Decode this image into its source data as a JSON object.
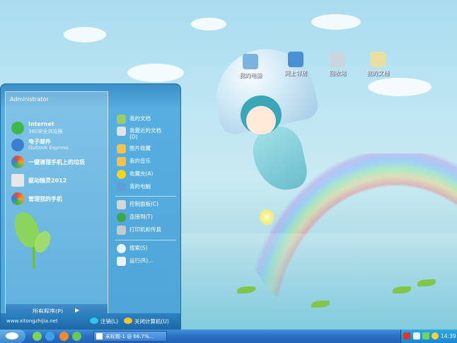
{
  "desktop": {
    "icons": [
      {
        "label": "我的电脑",
        "icon": "my-computer-icon",
        "color": "#7ab3e0"
      },
      {
        "label": "网上邻居",
        "icon": "network-icon",
        "color": "#4a8fd6"
      },
      {
        "label": "回收站",
        "icon": "recycle-bin-icon",
        "color": "#c9d6df"
      },
      {
        "label": "我的文档",
        "icon": "my-documents-icon",
        "color": "#e9e0a0"
      }
    ]
  },
  "start_menu": {
    "user": "Administrator",
    "pinned": [
      {
        "title": "Internet",
        "subtitle": "360安全浏览器",
        "icon": "browser-360-icon",
        "color": "#3fb84a"
      },
      {
        "title": "电子邮件",
        "subtitle": "Outlook Express",
        "icon": "mail-icon",
        "color": "#3c7fd0"
      },
      {
        "title": "一键清理手机上的垃圾",
        "subtitle": "",
        "icon": "phone-clean-icon",
        "color": "#f0a020"
      },
      {
        "title": "驱动精灵2012",
        "subtitle": "",
        "icon": "driver-genius-icon",
        "color": "#e7e7e7"
      },
      {
        "title": "管理我的手机",
        "subtitle": "",
        "icon": "phone-manager-icon",
        "color": "#e94e3c"
      }
    ],
    "all_programs": "所有程序(P)",
    "all_programs_arrow": "▶",
    "right_items": [
      {
        "label": "我的文档",
        "icon": "my-documents-icon",
        "color": "#9acd62"
      },
      {
        "label": "我最近的文档\n(D)",
        "icon": "recent-docs-icon",
        "color": "#e3e3e3"
      },
      {
        "label": "图片收藏",
        "icon": "my-pictures-icon",
        "color": "#f2c24c"
      },
      {
        "label": "我的音乐",
        "icon": "my-music-icon",
        "color": "#f2c24c"
      },
      {
        "label": "收藏夹(A)",
        "icon": "favorites-star-icon",
        "color": "#f7d21e"
      },
      {
        "label": "我的电脑",
        "icon": "my-computer-icon",
        "color": "#5e9fd8"
      },
      {
        "label": "控制面板(C)",
        "icon": "control-panel-icon",
        "color": "#d6d6d6"
      },
      {
        "label": "连接到(T)",
        "icon": "connect-to-icon",
        "color": "#3ba64a"
      },
      {
        "label": "打印机和传真",
        "icon": "printer-icon",
        "color": "#c9c9c9"
      },
      {
        "label": "搜索(S)",
        "icon": "search-icon",
        "color": "#e8f3fb"
      },
      {
        "label": "运行(R)...",
        "icon": "run-icon",
        "color": "#e8f3fb"
      }
    ],
    "footer": {
      "site": "www.xitongzhijia.net",
      "logoff": "注销(L)",
      "shutdown": "关闭计算机(U)",
      "logoff_color": "#34c4e8",
      "shutdown_color": "#f3c624"
    }
  },
  "taskbar": {
    "task": "未标题-1 @ 66.7%...",
    "clock": "14:39",
    "quick_launch": [
      {
        "icon": "show-desktop-icon",
        "color": "#7bd35a"
      },
      {
        "icon": "ie-icon",
        "color": "#3fa2e8"
      },
      {
        "icon": "media-player-icon",
        "color": "#f08a2a"
      },
      {
        "icon": "360-icon",
        "color": "#65c95c"
      }
    ],
    "tray": [
      {
        "icon": "antivirus-icon",
        "color": "#d6392c"
      },
      {
        "icon": "arrow-icon",
        "color": "#e6f2ff"
      },
      {
        "icon": "network-tray-icon",
        "color": "#6ed45b"
      },
      {
        "icon": "shield-tray-icon",
        "color": "#f2d43a"
      }
    ]
  }
}
